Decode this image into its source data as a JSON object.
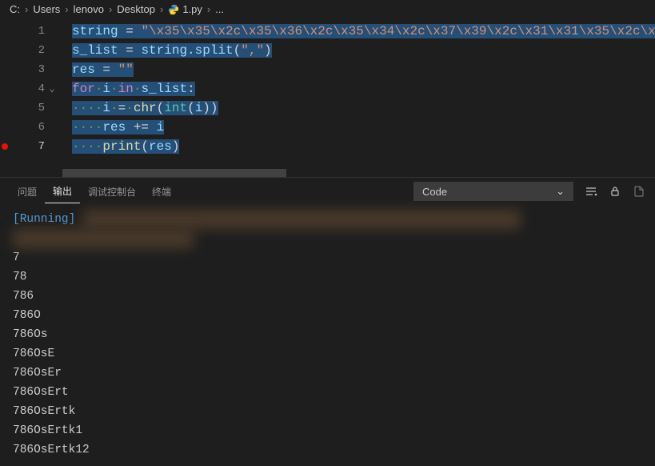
{
  "breadcrumb": {
    "parts": [
      "C:",
      "Users",
      "lenovo",
      "Desktop"
    ],
    "file": "1.py",
    "more": "..."
  },
  "code": {
    "lines": [
      {
        "n": 1,
        "segments": [
          {
            "t": "string",
            "c": "tk-var",
            "s": true
          },
          {
            "t": " ",
            "c": "tk-op",
            "s": true
          },
          {
            "t": "=",
            "c": "tk-op",
            "s": true
          },
          {
            "t": " ",
            "c": "tk-op",
            "s": true
          },
          {
            "t": "\"\\x35\\x35\\x2c\\x35\\x36\\x2c\\x35\\x34\\x2c\\x37\\x39\\x2c\\x31\\x31\\x35\\x2c\\x",
            "c": "tk-str",
            "s": true
          }
        ]
      },
      {
        "n": 2,
        "segments": [
          {
            "t": "s_list",
            "c": "tk-var",
            "s": true
          },
          {
            "t": " ",
            "c": "tk-op",
            "s": true
          },
          {
            "t": "=",
            "c": "tk-op",
            "s": true
          },
          {
            "t": " ",
            "c": "tk-op",
            "s": true
          },
          {
            "t": "string.split",
            "c": "tk-var",
            "s": true
          },
          {
            "t": "(",
            "c": "tk-pun",
            "s": true
          },
          {
            "t": "\",\"",
            "c": "tk-str",
            "s": true
          },
          {
            "t": ")",
            "c": "tk-pun",
            "s": true
          }
        ]
      },
      {
        "n": 3,
        "segments": [
          {
            "t": "res",
            "c": "tk-var",
            "s": true
          },
          {
            "t": " ",
            "c": "tk-op",
            "s": true
          },
          {
            "t": "=",
            "c": "tk-op",
            "s": true
          },
          {
            "t": " ",
            "c": "tk-op",
            "s": true
          },
          {
            "t": "\"\"",
            "c": "tk-str",
            "s": true
          }
        ]
      },
      {
        "n": 4,
        "fold": true,
        "segments": [
          {
            "t": "for",
            "c": "tk-kw",
            "s": true
          },
          {
            "t": "·",
            "c": "tk-dot",
            "s": true
          },
          {
            "t": "i",
            "c": "tk-var",
            "s": true
          },
          {
            "t": "·",
            "c": "tk-dot",
            "s": true
          },
          {
            "t": "in",
            "c": "tk-kw",
            "s": true
          },
          {
            "t": "·",
            "c": "tk-dot",
            "s": true
          },
          {
            "t": "s_list",
            "c": "tk-var",
            "s": true
          },
          {
            "t": ":",
            "c": "tk-pun",
            "s": true
          }
        ]
      },
      {
        "n": 5,
        "segments": [
          {
            "t": "····",
            "c": "tk-dot",
            "s": true
          },
          {
            "t": "i",
            "c": "tk-var",
            "s": true
          },
          {
            "t": "·",
            "c": "tk-dot",
            "s": true
          },
          {
            "t": "=",
            "c": "tk-op",
            "s": true
          },
          {
            "t": "·",
            "c": "tk-dot",
            "s": true
          },
          {
            "t": "chr",
            "c": "tk-func",
            "s": true
          },
          {
            "t": "(",
            "c": "tk-pun",
            "s": true
          },
          {
            "t": "int",
            "c": "tk-builtin",
            "s": true
          },
          {
            "t": "(",
            "c": "tk-pun",
            "s": true
          },
          {
            "t": "i",
            "c": "tk-var",
            "s": true
          },
          {
            "t": ")",
            "c": "tk-pun",
            "s": true
          },
          {
            "t": ")",
            "c": "tk-pun",
            "s": true
          }
        ]
      },
      {
        "n": 6,
        "segments": [
          {
            "t": "····",
            "c": "tk-dot",
            "s": true
          },
          {
            "t": "res",
            "c": "tk-var",
            "s": true
          },
          {
            "t": " ",
            "c": "tk-op",
            "s": true
          },
          {
            "t": "+=",
            "c": "tk-op",
            "s": true
          },
          {
            "t": " ",
            "c": "tk-op",
            "s": true
          },
          {
            "t": "i",
            "c": "tk-var",
            "s": true
          }
        ]
      },
      {
        "n": 7,
        "current": true,
        "breakpoint": true,
        "segments": [
          {
            "t": "····",
            "c": "tk-dot",
            "s": true
          },
          {
            "t": "print",
            "c": "tk-func",
            "s": true
          },
          {
            "t": "(",
            "c": "tk-pun",
            "s": true
          },
          {
            "t": "res",
            "c": "tk-var",
            "s": true
          },
          {
            "t": ")",
            "c": "tk-pun",
            "s": true
          }
        ]
      }
    ]
  },
  "panel": {
    "tabs": {
      "problems": "问题",
      "output": "输出",
      "debug_console": "调试控制台",
      "terminal": "终端"
    },
    "filter_selected": "Code",
    "output_lines": [
      "7",
      "78",
      "786",
      "786O",
      "786Os",
      "786OsE",
      "786OsEr",
      "786OsErt",
      "786OsErtk",
      "786OsErtk1",
      "786OsErtk12"
    ],
    "running_text": "[Running]"
  }
}
